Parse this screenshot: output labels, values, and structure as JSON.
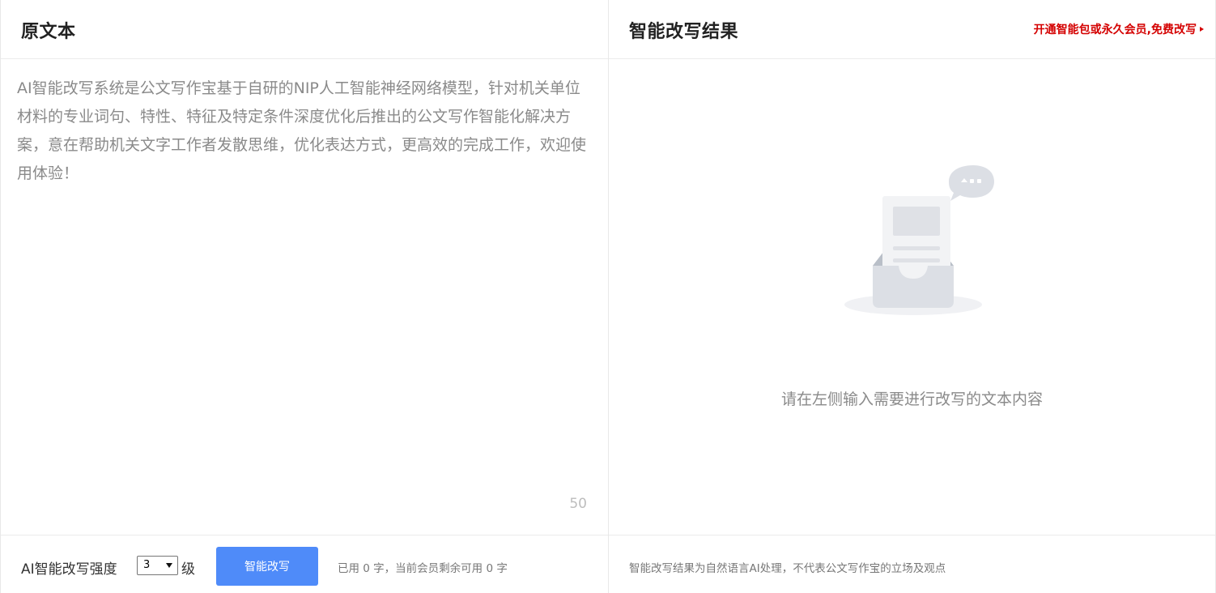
{
  "left_panel": {
    "title": "原文本",
    "source_text": "AI智能改写系统是公文写作宝基于自研的NIP人工智能神经网络模型，针对机关单位材料的专业词句、特性、特征及特定条件深度优化后推出的公文写作智能化解决方案，意在帮助机关文字工作者发散思维，优化表达方式，更高效的完成工作，欢迎使用体验！",
    "char_count": "50",
    "strength_label": "AI智能改写强度",
    "strength_value": "3",
    "strength_unit": "级",
    "rewrite_button": "智能改写",
    "usage_text": "已用 0 字，当前会员剩余可用 0 字"
  },
  "right_panel": {
    "title": "智能改写结果",
    "promo_link": "开通智能包或永久会员,免费改写",
    "empty_message": "请在左侧输入需要进行改写的文本内容",
    "empty_icon": "empty-inbox-icon",
    "disclaimer": "智能改写结果为自然语言AI处理，不代表公文写作宝的立场及观点"
  },
  "colors": {
    "accent": "#4f8bf9",
    "promo": "#d40000",
    "border": "#ebebeb"
  }
}
